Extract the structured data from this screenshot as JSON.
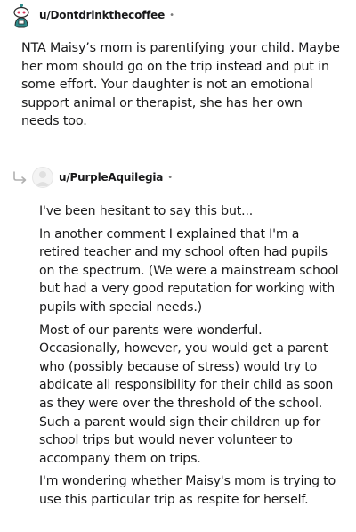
{
  "comment1": {
    "username": "u/Dontdrinkthecoffee",
    "separator": "•",
    "paragraphs": [
      "NTA Maisy’s mom is parentifying your child. Maybe her mom should go on the trip instead and put in some effort. Your daughter is not an emotional support animal or therapist, she has her own needs too."
    ]
  },
  "comment2": {
    "username": "u/PurpleAquilegia",
    "separator": "•",
    "paragraphs": [
      "I've been hesitant to say this but...",
      "In another comment I explained that I'm a retired teacher and my school often had pupils on the spectrum. (We were a mainstream school but had a very good reputation for working with pupils with special needs.)",
      "Most of our parents were wonderful. Occasionally, however, you would get a parent who (possibly because of stress) would try to abdicate all responsibility for their child as soon as they were over the threshold of the school. Such a parent would sign their children up for school trips but would never volunteer to accompany them on trips.",
      "I'm wondering whether Maisy's mom is trying to use this particular trip as respite for herself."
    ]
  },
  "colors": {
    "text": "#1a1a1b",
    "muted": "#7c7c7c",
    "avatar_accent": "#2e8b8b"
  },
  "icons": {
    "avatar1": "snoo-avatar-icon",
    "avatar2": "default-avatar-icon",
    "reply": "reply-arrow-icon"
  }
}
